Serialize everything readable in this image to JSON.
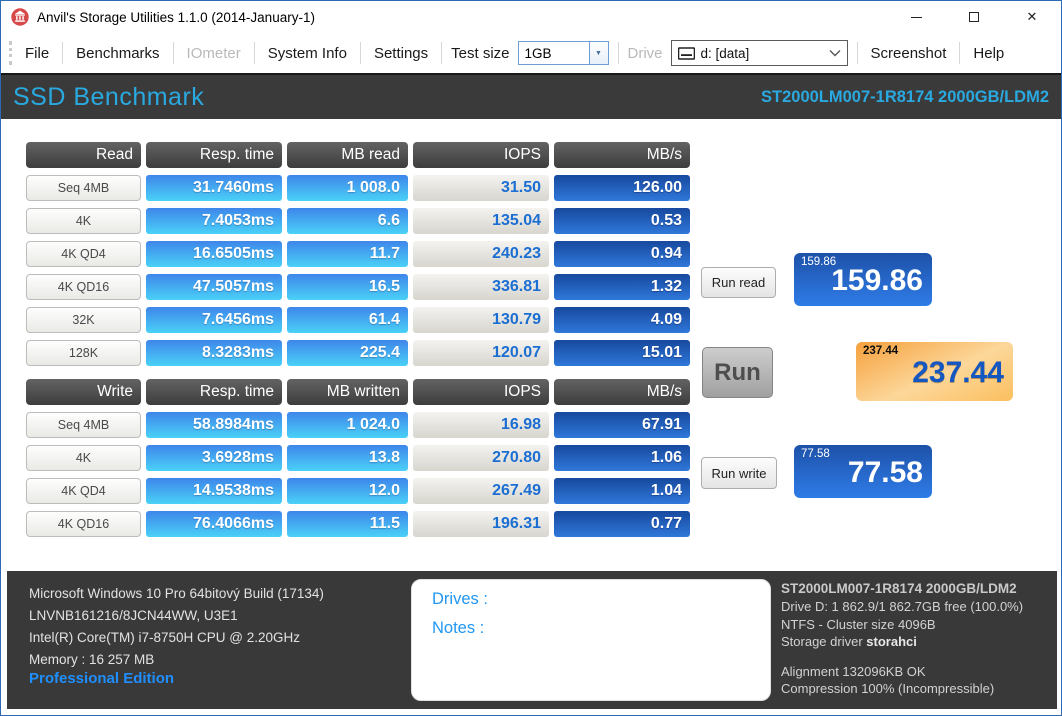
{
  "window": {
    "title": "Anvil's Storage Utilities 1.1.0 (2014-January-1)"
  },
  "menu": {
    "items": [
      "File",
      "Benchmarks",
      "IOmeter",
      "System Info",
      "Settings"
    ],
    "test_size_label": "Test size",
    "test_size_value": "1GB",
    "drive_label": "Drive",
    "drive_value": "d: [data]",
    "screenshot": "Screenshot",
    "help": "Help"
  },
  "header": {
    "title": "SSD Benchmark",
    "device": "ST2000LM007-1R8174 2000GB/LDM2"
  },
  "read_table": {
    "headers": [
      "Read",
      "Resp. time",
      "MB read",
      "IOPS",
      "MB/s"
    ],
    "rows": [
      {
        "label": "Seq 4MB",
        "resp": "31.7460ms",
        "mb": "1 008.0",
        "iops": "31.50",
        "mbs": "126.00"
      },
      {
        "label": "4K",
        "resp": "7.4053ms",
        "mb": "6.6",
        "iops": "135.04",
        "mbs": "0.53"
      },
      {
        "label": "4K QD4",
        "resp": "16.6505ms",
        "mb": "11.7",
        "iops": "240.23",
        "mbs": "0.94"
      },
      {
        "label": "4K QD16",
        "resp": "47.5057ms",
        "mb": "16.5",
        "iops": "336.81",
        "mbs": "1.32"
      },
      {
        "label": "32K",
        "resp": "7.6456ms",
        "mb": "61.4",
        "iops": "130.79",
        "mbs": "4.09"
      },
      {
        "label": "128K",
        "resp": "8.3283ms",
        "mb": "225.4",
        "iops": "120.07",
        "mbs": "15.01"
      }
    ]
  },
  "write_table": {
    "headers": [
      "Write",
      "Resp. time",
      "MB written",
      "IOPS",
      "MB/s"
    ],
    "rows": [
      {
        "label": "Seq 4MB",
        "resp": "58.8984ms",
        "mb": "1 024.0",
        "iops": "16.98",
        "mbs": "67.91"
      },
      {
        "label": "4K",
        "resp": "3.6928ms",
        "mb": "13.8",
        "iops": "270.80",
        "mbs": "1.06"
      },
      {
        "label": "4K QD4",
        "resp": "14.9538ms",
        "mb": "12.0",
        "iops": "267.49",
        "mbs": "1.04"
      },
      {
        "label": "4K QD16",
        "resp": "76.4066ms",
        "mb": "11.5",
        "iops": "196.31",
        "mbs": "0.77"
      }
    ]
  },
  "actions": {
    "run_read": "Run read",
    "run": "Run",
    "run_write": "Run write"
  },
  "scores": {
    "read": "159.86",
    "total": "237.44",
    "write": "77.58"
  },
  "footer": {
    "system_lines": [
      "Microsoft Windows 10 Pro 64bitový Build (17134)",
      "LNVNB161216/8JCN44WW, U3E1",
      "Intel(R) Core(TM) i7-8750H CPU @ 2.20GHz",
      "Memory : 16 257 MB"
    ],
    "edition": "Professional Edition",
    "drives_label": "Drives :",
    "notes_label": "Notes :",
    "device_title": "ST2000LM007-1R8174 2000GB/LDM2",
    "drive_lines": [
      "Drive D: 1 862.9/1 862.7GB free (100.0%)",
      "NTFS - Cluster size 4096B"
    ],
    "storage_driver_label": "Storage driver",
    "storage_driver_value": "storahci",
    "extra_lines": [
      "Alignment 132096KB OK",
      "Compression 100% (Incompressible)"
    ]
  },
  "colors": {
    "accent_cyan": "#2aa9e0",
    "band_bg": "#3a3a3a",
    "cell_blue_top": "#3e86ea",
    "cell_blue_bottom": "#4ad1f7",
    "cell_mbs_top": "#17499e",
    "cell_mbs_bottom": "#2f78da",
    "iops_text": "#1b6ed2",
    "score_blue_top": "#1d51a8",
    "score_blue_bottom": "#2f7ce8",
    "score_orange": "#fbbf5e",
    "score_total_text": "#1457c0",
    "edition_blue": "#1f8fff",
    "notes_label_blue": "#2196f3",
    "window_border": "#2d6ab4"
  }
}
